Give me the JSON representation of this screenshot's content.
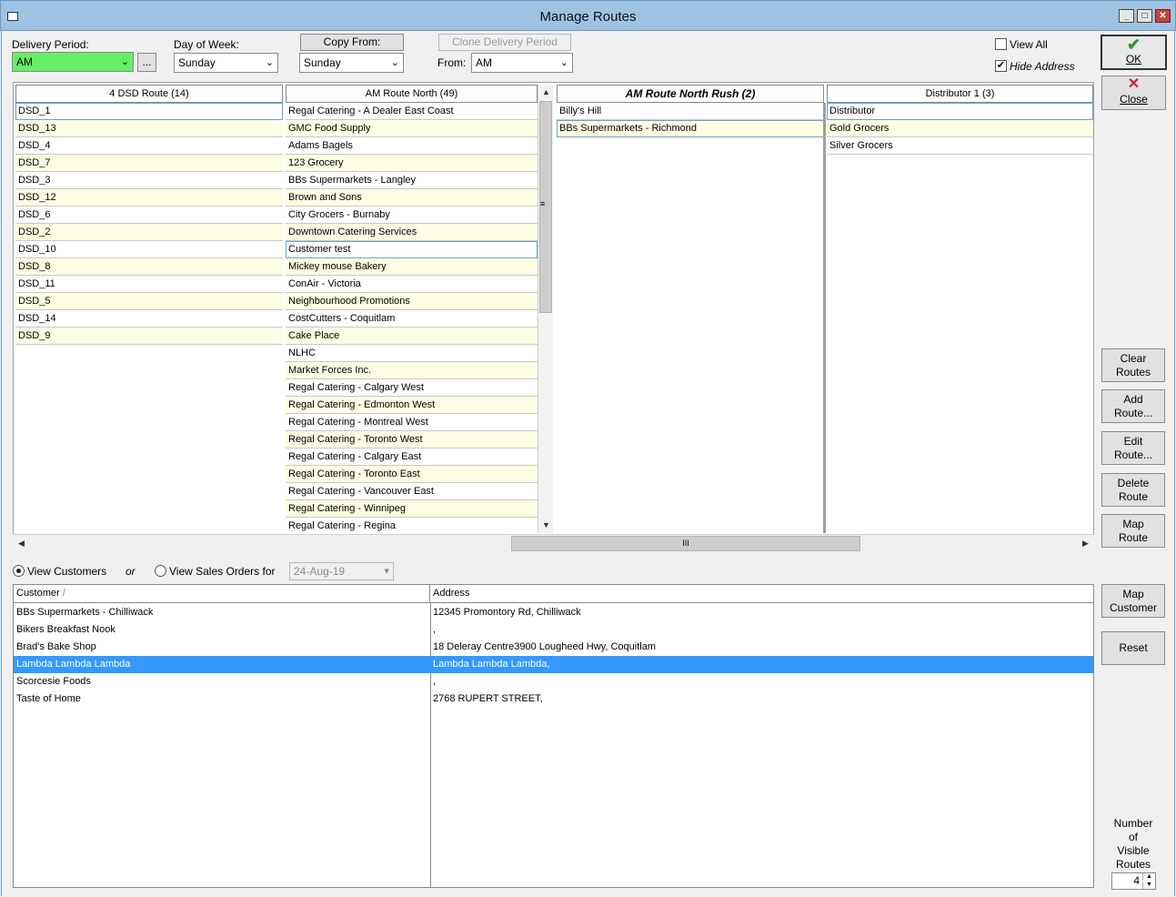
{
  "window": {
    "title": "Manage Routes"
  },
  "top": {
    "delivery_period_label": "Delivery Period:",
    "delivery_period_value": "AM",
    "delivery_period_more": "...",
    "day_of_week_label": "Day of Week:",
    "day_of_week_value": "Sunday",
    "copy_from_button": "Copy From:",
    "copy_from_value": "Sunday",
    "clone_button": "Clone Delivery Period",
    "from_label": "From:",
    "from_value": "AM",
    "view_all_label": "View All",
    "hide_address_label": "Hide Address",
    "view_all_checked": false,
    "hide_address_checked": true
  },
  "side_buttons": {
    "ok": "OK",
    "close": "Close",
    "clear_routes": [
      "Clear",
      "Routes"
    ],
    "add_route": [
      "Add",
      "Route..."
    ],
    "edit_route": [
      "Edit",
      "Route..."
    ],
    "delete_route": [
      "Delete",
      "Route"
    ],
    "map_route": [
      "Map",
      "Route"
    ],
    "map_customer": [
      "Map",
      "Customer"
    ],
    "reset": "Reset"
  },
  "routes": [
    {
      "header": "4 DSD Route (14)",
      "bold": false,
      "items": [
        "DSD_1",
        "DSD_13",
        "DSD_4",
        "DSD_7",
        "DSD_3",
        "DSD_12",
        "DSD_6",
        "DSD_2",
        "DSD_10",
        "DSD_8",
        "DSD_11",
        "DSD_5",
        "DSD_14",
        "DSD_9"
      ],
      "focus": 0
    },
    {
      "header": "AM Route North (49)",
      "bold": false,
      "items": [
        "Regal Catering - A Dealer East Coast",
        "GMC Food Supply",
        "Adams Bagels",
        "123 Grocery",
        "BBs Supermarkets - Langley",
        "Brown and Sons",
        "City Grocers - Burnaby",
        "Downtown Catering Services",
        "Customer test",
        "Mickey mouse Bakery",
        "ConAir - Victoria",
        "Neighbourhood Promotions",
        "CostCutters - Coquitlam",
        "Cake Place",
        "NLHC",
        "Market Forces Inc.",
        "Regal Catering - Calgary West",
        "Regal Catering - Edmonton West",
        "Regal Catering - Montreal West",
        "Regal Catering - Toronto West",
        "Regal Catering - Calgary East",
        "Regal Catering - Toronto East",
        "Regal Catering - Vancouver East",
        "Regal Catering - Winnipeg",
        "Regal Catering - Regina"
      ],
      "focus": 8
    },
    {
      "header": "AM Route North Rush (2)",
      "bold": true,
      "items": [
        "Billy's Hill",
        "BBs Supermarkets - Richmond"
      ],
      "focus": 1
    },
    {
      "header": "Distributor 1 (3)",
      "bold": false,
      "items": [
        "Distributor",
        "Gold Grocers",
        "Silver Grocers"
      ],
      "focus": 0
    }
  ],
  "view_options": {
    "view_customers_label": "View Customers",
    "or_label": "or",
    "view_sales_orders_label": "View Sales Orders for",
    "date_value": "24-Aug-19",
    "selected": "customers"
  },
  "grid": {
    "columns": [
      "Customer",
      "Address"
    ],
    "sort_indicator": "/",
    "rows": [
      [
        "BBs Supermarkets - Chilliwack",
        "12345 Promontory Rd, Chilliwack"
      ],
      [
        "Bikers Breakfast Nook",
        ","
      ],
      [
        "Brad's Bake Shop",
        "18 Deleray Centre3900 Lougheed Hwy, Coquitlam"
      ],
      [
        "Lambda Lambda Lambda",
        "Lambda Lambda Lambda,"
      ],
      [
        "Scorcesie Foods",
        ","
      ],
      [
        "Taste of Home",
        "2768 RUPERT STREET,"
      ]
    ],
    "selected_row": 3
  },
  "visible_routes": {
    "label": [
      "Number",
      "of",
      "Visible",
      "Routes"
    ],
    "value": "4"
  },
  "colors": {
    "delivery_period_bg": "#66ee66",
    "row_alt": "#fdfde3",
    "selection": "#3399ff",
    "ok_check": "#2e9a2e",
    "close_x": "#d41f1f"
  }
}
